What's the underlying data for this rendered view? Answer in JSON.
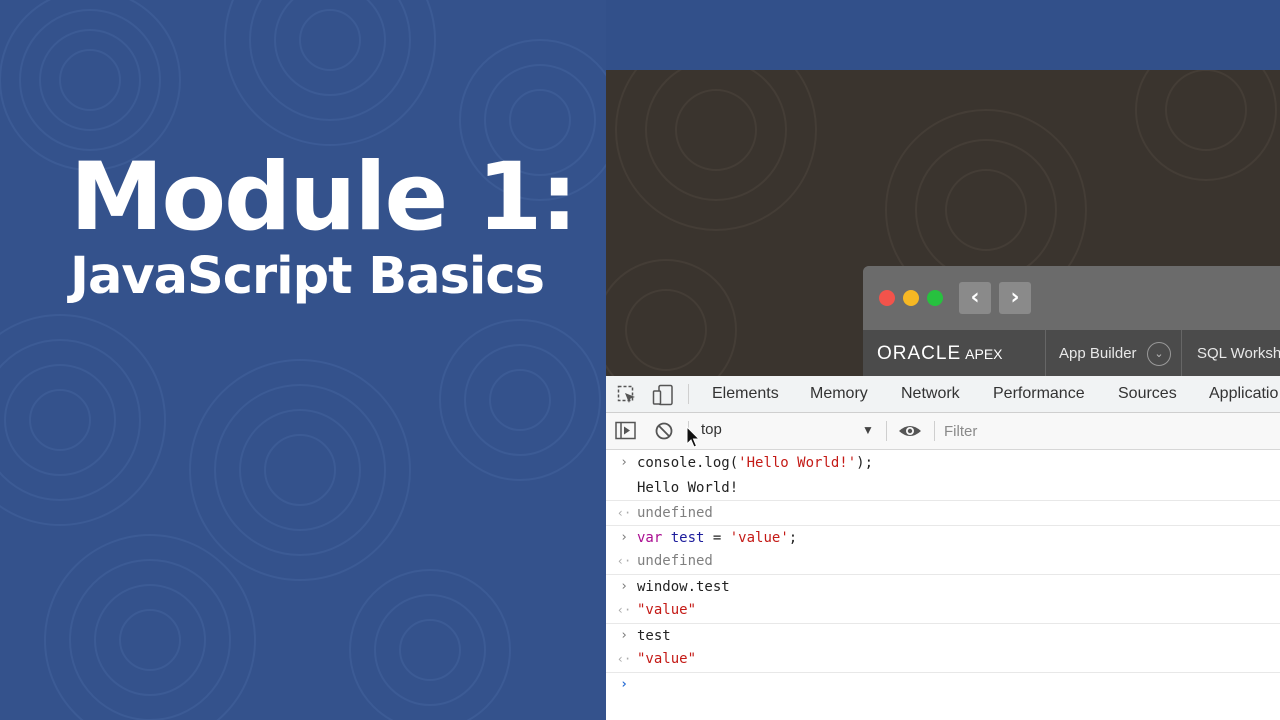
{
  "slide": {
    "title_line1": "Module 1:",
    "title_line2": "JavaScript Basics"
  },
  "browser": {
    "back_glyph": "‹",
    "forward_glyph": "›",
    "apex_brand": "ORACLE",
    "apex_product": "APEX",
    "nav_app_builder": "App Builder",
    "nav_chevron": "⌄",
    "nav_sql_workshop": "SQL Workshe"
  },
  "devtools": {
    "tabs": [
      "Elements",
      "Memory",
      "Network",
      "Performance",
      "Sources",
      "Applicatio"
    ],
    "context": "top",
    "context_arrow": "▼",
    "filter_placeholder": "Filter"
  },
  "console": {
    "line1_prefix": "console.log(",
    "line1_string": "'Hello World!'",
    "line1_suffix": ");",
    "line2_output": "Hello World!",
    "line3_result": "undefined",
    "line4_keyword": "var",
    "line4_name": "test",
    "line4_eq": " = ",
    "line4_string": "'value'",
    "line4_suffix": ";",
    "line5_result": "undefined",
    "line6_input": "window.test",
    "line7_result": "\"value\"",
    "line8_input": "test",
    "line9_result": "\"value\""
  },
  "colors": {
    "slide_blue": "#34528c",
    "console_string": "#c41a16",
    "console_keyword": "#aa0d91"
  }
}
